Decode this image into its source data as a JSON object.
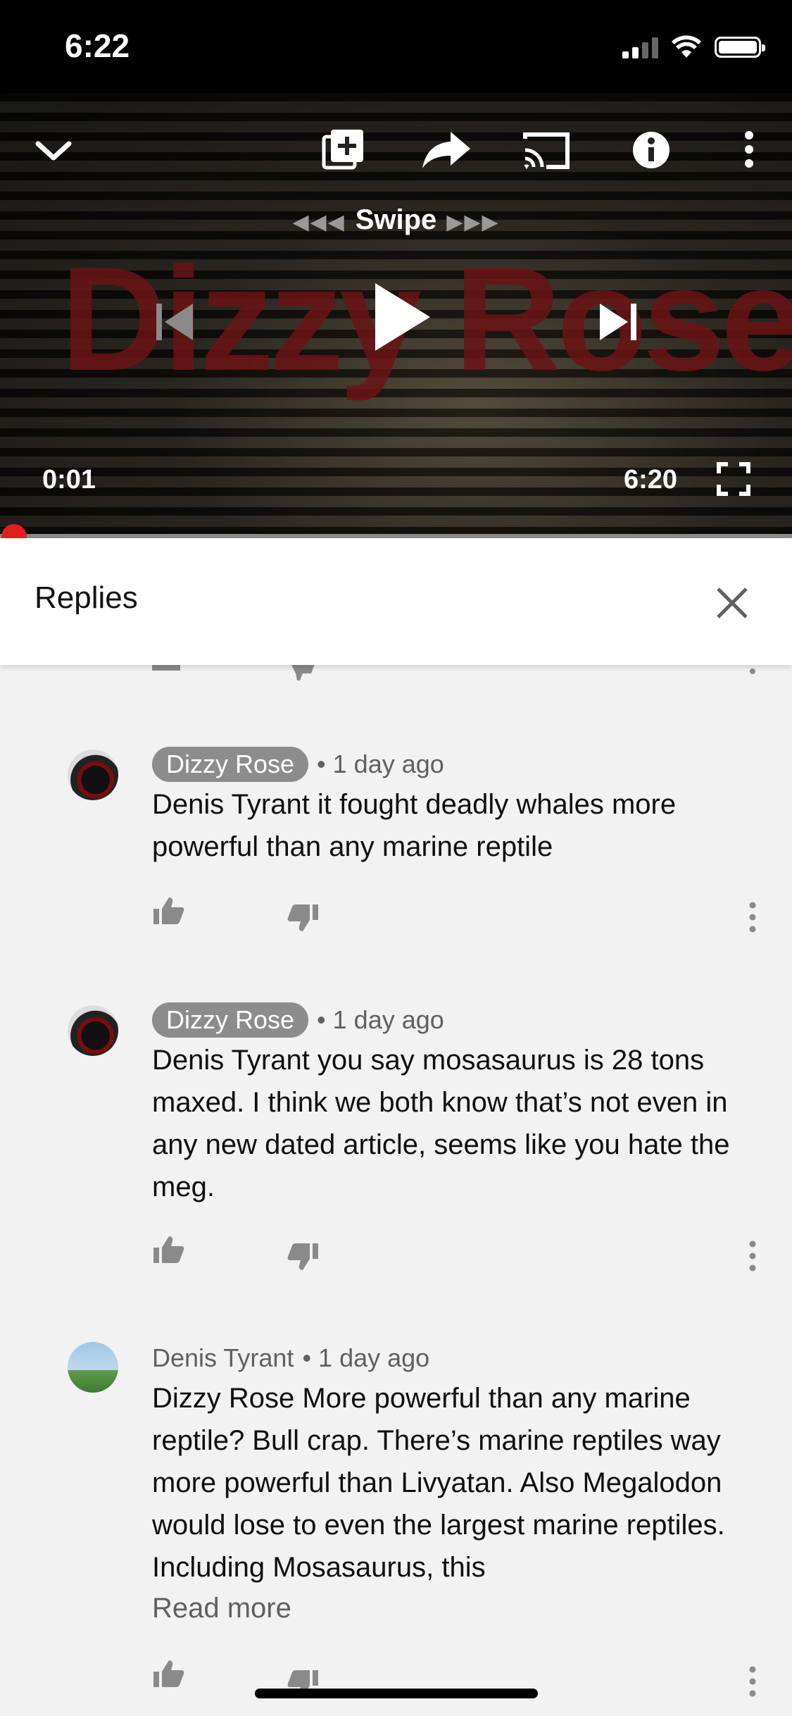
{
  "status_bar": {
    "time": "6:22"
  },
  "player": {
    "background_title": "Dizzy Rose",
    "swipe_label": "Swipe",
    "elapsed": "0:01",
    "duration": "6:20",
    "progress": 0.003
  },
  "replies_panel": {
    "title": "Replies"
  },
  "comments": [
    {
      "author": "Dizzy Rose",
      "author_badge": true,
      "time": "1 day ago",
      "text": "Denis Tyrant it fought deadly whales more powerful than any marine reptile"
    },
    {
      "author": "Dizzy Rose",
      "author_badge": true,
      "time": "1 day ago",
      "text": "Denis Tyrant you say mosasaurus is 28 tons maxed. I think we both know that’s not even in any new dated article, seems like you hate the meg."
    },
    {
      "author": "Denis Tyrant",
      "author_badge": false,
      "time": "1 day ago",
      "text": "Dizzy Rose More powerful than any marine reptile? Bull crap. There’s marine reptiles way more powerful than Livyatan. Also Megalodon would lose to even the largest marine reptiles. Including Mosasaurus, this",
      "read_more": "Read more"
    }
  ],
  "colors": {
    "accent": "#e0201c",
    "badge": "#8c8c8c"
  }
}
